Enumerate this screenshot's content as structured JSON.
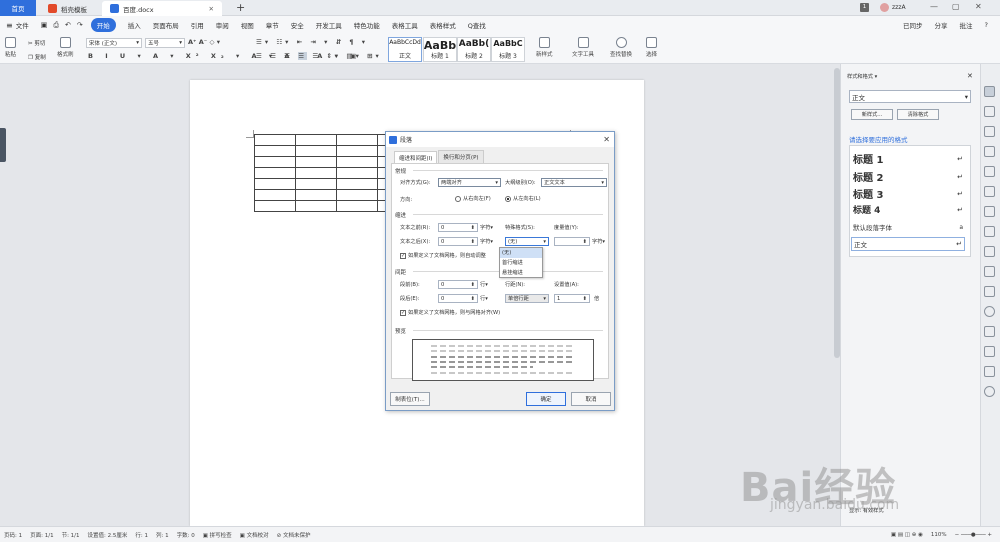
{
  "tabs": {
    "home": "首页",
    "t1": "稻壳模板",
    "t2": "百度.docx",
    "plus": "+"
  },
  "topright": {
    "badge": "1",
    "user": "zzzA",
    "minimize": "—",
    "maximize": "▢",
    "close": "✕"
  },
  "menu": [
    "文件",
    "开始",
    "插入",
    "页面布局",
    "引用",
    "审阅",
    "视图",
    "章节",
    "安全",
    "开发工具",
    "特色功能",
    "表格工具",
    "表格样式",
    "Q查找"
  ],
  "menu_right": [
    "已同步",
    "分享",
    "批注",
    "?"
  ],
  "ribbon": {
    "paste": "粘贴",
    "cut": "剪切",
    "copy": "复制",
    "format": "格式刷",
    "font": "宋体 (正文)",
    "size": "五号",
    "styles": [
      {
        "preview": "AaBbCcDd",
        "name": "正文"
      },
      {
        "preview": "AaBb",
        "name": "标题 1"
      },
      {
        "preview": "AaBb(",
        "name": "标题 2"
      },
      {
        "preview": "AaBbC",
        "name": "标题 3"
      }
    ],
    "newstyle": "新样式",
    "texttools": "文字工具",
    "findreplace": "查找替换",
    "select": "选择"
  },
  "dialog": {
    "title": "段落",
    "tab1": "缩进和间距(I)",
    "tab2": "换行和分页(P)",
    "general": "常规",
    "align_label": "对齐方式(G):",
    "align_val": "两端对齐",
    "outline_label": "大纲级别(O):",
    "outline_val": "正文文本",
    "dir_label": "方向:",
    "dir_rtl": "从右向左(F)",
    "dir_ltr": "从左向右(L)",
    "indent": "缩进",
    "before_text": "文本之前(R):",
    "before_val": "0",
    "unit_char": "字符▾",
    "special_label": "特殊格式(S):",
    "special_val": "(无)",
    "measure_label": "度量值(Y):",
    "after_text": "文本之后(X):",
    "after_val": "0",
    "auto_adjust": "如果定义了文档网格，则自动调整",
    "spacing": "间距",
    "space_before": "段前(B):",
    "space_before_val": "0",
    "unit_line": "行▾",
    "line_spacing_label": "行距(N):",
    "line_spacing_val": "单倍行距",
    "set_val_label": "设置值(A):",
    "set_val": "1",
    "unit_times": "倍",
    "space_after": "段后(E):",
    "space_after_val": "0",
    "grid_align": "如果定义了文档网格，则与网格对齐(W)",
    "preview": "预览",
    "tabs_button": "制表位(T)...",
    "ok": "确定",
    "cancel": "取消",
    "dropdown": [
      "(无)",
      "首行缩进",
      "悬挂缩进"
    ]
  },
  "panel": {
    "title": "样式和格式 ▾",
    "current": "正文",
    "new_style": "新样式...",
    "clear": "清除格式",
    "choose": "请选择要应用的格式",
    "items": [
      {
        "name": "标题  1",
        "mark": "↵"
      },
      {
        "name": "标题  2",
        "mark": "↵"
      },
      {
        "name": "标题  3",
        "mark": "↵"
      },
      {
        "name": "标题  4",
        "mark": "↵"
      },
      {
        "name": "默认段落字体",
        "mark": "a"
      },
      {
        "name": "正文",
        "mark": "↵"
      }
    ],
    "show": "显示: 有效样式"
  },
  "status": [
    "页码: 1",
    "页面: 1/1",
    "节: 1/1",
    "设置值: 2.5厘米",
    "行: 1",
    "列: 1",
    "字数: 0",
    "拼写检查",
    "文档校对",
    "文档未保护"
  ],
  "zoom": "110%",
  "watermark": "Bai经验",
  "watermark2": "jingyan.baidu.com",
  "colors": {
    "accent": "#2f6fdc"
  }
}
